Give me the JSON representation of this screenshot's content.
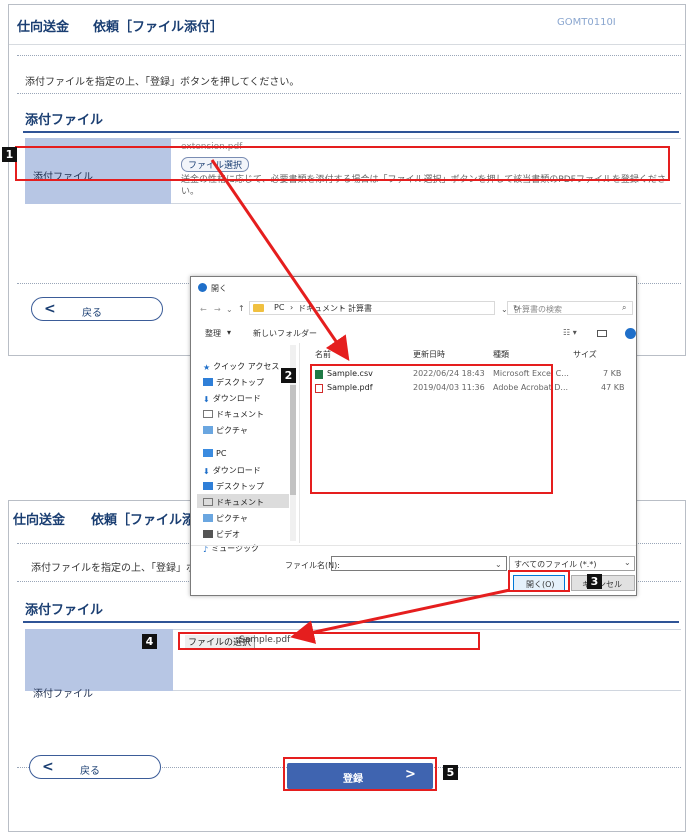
{
  "top_panel": {
    "title": "仕向送金",
    "subtitle": "依頼［ファイル添付］",
    "screen_code": "GOMT0110I",
    "instruction": "添付ファイルを指定の上、「登録」ボタンを押してください。",
    "section_title": "添付ファイル",
    "row_label": "添付ファイル",
    "existing_file": "extension.pdf",
    "file_select_button": "ファイル選択",
    "note": "送金の性格に応じて、必要書類を添付する場合は「ファイル選択」ボタンを押して該当書類のPDFファイルを登録ください。",
    "back_label": "戻る"
  },
  "dialog": {
    "title": "開く",
    "path": [
      "PC",
      "ドキュメント",
      "計算書"
    ],
    "search_placeholder": "計算書の検索",
    "organize": "整理",
    "new_folder": "新しいフォルダー",
    "columns": [
      "名前",
      "更新日時",
      "種類",
      "サイズ"
    ],
    "nav_items": [
      "クイック アクセス",
      "デスクトップ",
      "ダウンロード",
      "ドキュメント",
      "ピクチャ",
      "PC",
      "ダウンロード",
      "デスクトップ",
      "ドキュメント",
      "ピクチャ",
      "ビデオ",
      "ミュージック"
    ],
    "files": [
      {
        "name": "Sample.csv",
        "date": "2022/06/24 18:43",
        "type": "Microsoft Excel C...",
        "size": "7 KB"
      },
      {
        "name": "Sample.pdf",
        "date": "2019/04/03 11:36",
        "type": "Adobe Acrobat D...",
        "size": "47 KB"
      }
    ],
    "filename_label": "ファイル名(N):",
    "filter": "すべてのファイル (*.*)",
    "open_button": "開く(O)",
    "cancel_button": "キャンセル"
  },
  "bottom_panel": {
    "title": "仕向送金",
    "subtitle": "依頼［ファイル添付］",
    "instruction": "添付ファイルを指定の上、「登録」ボタンを押してください。",
    "section_title": "添付ファイル",
    "row_label": "添付ファイル",
    "file_select_button": "ファイルの選択",
    "selected_file": "Sample.pdf",
    "back_label": "戻る",
    "register_label": "登録"
  },
  "badges": [
    "1",
    "2",
    "3",
    "4",
    "5"
  ],
  "colors": {
    "accent": "#1a3e72",
    "label_bg": "#b7c6e4",
    "register_bg": "#3f64b0",
    "annotation_red": "#e51e1e"
  }
}
